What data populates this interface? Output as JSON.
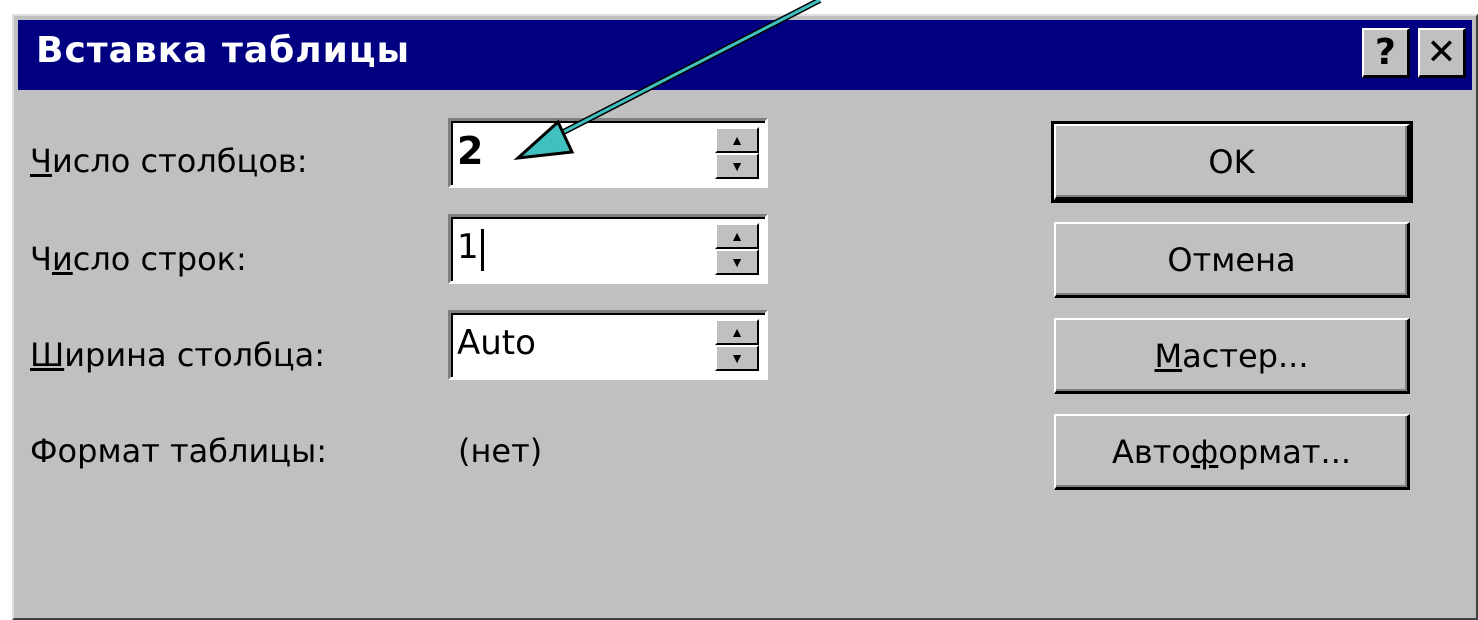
{
  "dialog": {
    "title": "Вставка таблицы",
    "help_button": "?",
    "close_button": "✕"
  },
  "fields": {
    "columns": {
      "label_prefix": "",
      "label_mnemonic": "Ч",
      "label_rest": "исло столбцов:",
      "value": "2"
    },
    "rows": {
      "label_prefix": "Ч",
      "label_mnemonic": "и",
      "label_rest": "сло строк:",
      "value": "1"
    },
    "width": {
      "label_prefix": "",
      "label_mnemonic": "Ш",
      "label_rest": "ирина столбца:",
      "value": "Auto"
    }
  },
  "format": {
    "label": "Формат таблицы:",
    "value": "(нет)"
  },
  "buttons": {
    "ok": "OK",
    "cancel": "Отмена",
    "wizard_mnemonic": "М",
    "wizard_rest": "астер...",
    "autoformat_prefix": "Авто",
    "autoformat_mnemonic": "ф",
    "autoformat_rest": "ормат..."
  },
  "spin": {
    "up": "▲",
    "down": "▼"
  },
  "colors": {
    "titlebar": "#000080",
    "dialog": "#c0c0c0",
    "arrow": "#40c0c0"
  }
}
